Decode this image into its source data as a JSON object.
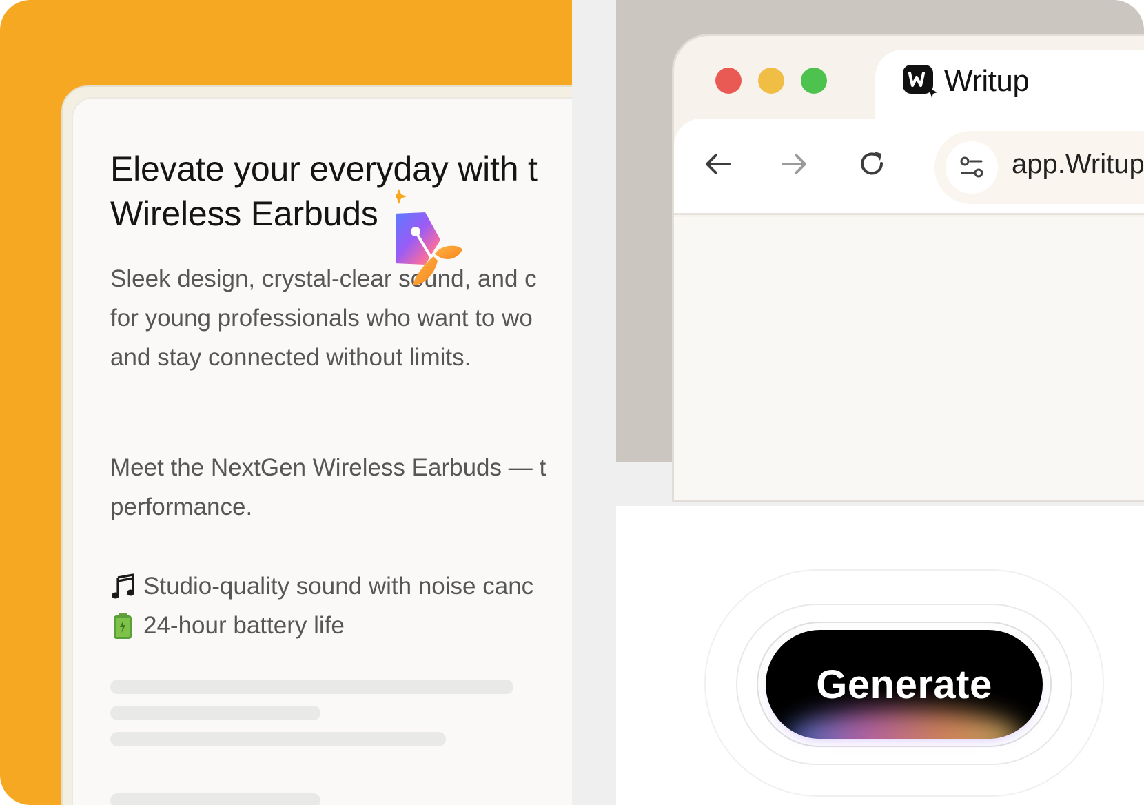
{
  "document": {
    "headline_line1": "Elevate your everyday with t",
    "headline_line2": "Wireless Earbuds",
    "subhead_line1": "Sleek design, crystal-clear sound, and c",
    "subhead_line2": "for young professionals who want to wo",
    "subhead_line3": "and stay connected without limits.",
    "intro_line1": "Meet the NextGen Wireless Earbuds — t",
    "intro_line2": "performance.",
    "features": [
      {
        "emoji": "🎵",
        "text": "Studio-quality sound with noise canc"
      },
      {
        "emoji": "🔋",
        "text": "24-hour battery life"
      }
    ]
  },
  "browser": {
    "tab_title": "Writup",
    "url": "app.Writup",
    "window_dots": [
      "#ea5a55",
      "#f0be45",
      "#4ec24f"
    ]
  },
  "generate": {
    "label": "Generate"
  },
  "colors": {
    "left_background": "#f7a823",
    "highlight": "#ffd15a",
    "button": "#000000"
  },
  "icons": [
    "sparkle-icon",
    "pen-nib-logo-icon",
    "writup-logo-icon",
    "back-arrow-icon",
    "forward-arrow-icon",
    "reload-icon",
    "site-settings-icon",
    "music-note-icon",
    "battery-icon"
  ]
}
